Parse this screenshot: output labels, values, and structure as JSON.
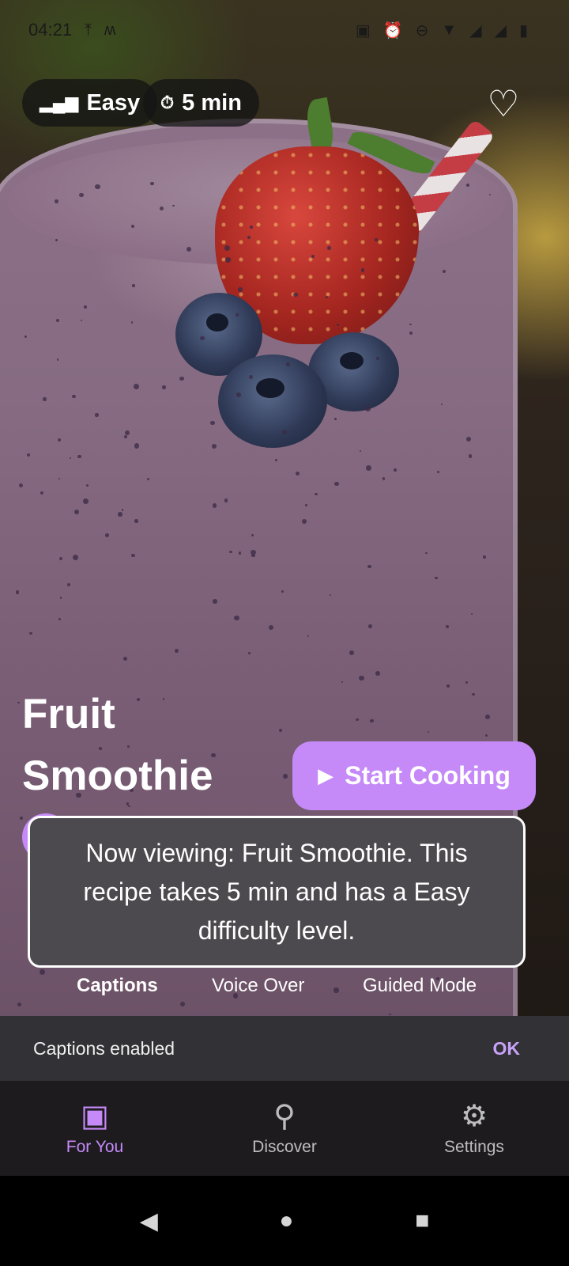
{
  "status_bar": {
    "time": "04:21",
    "left_icons": [
      "upload-icon",
      "m-logo-icon"
    ],
    "right_icons": [
      "nfc-icon",
      "alarm-icon",
      "do-not-disturb-icon",
      "wifi-icon",
      "signal-icon",
      "signal-icon",
      "battery-icon"
    ]
  },
  "recipe": {
    "difficulty": "Easy",
    "time": "5 min",
    "title": "Fruit Smoothie",
    "start_label": "Start Cooking",
    "favorite": false
  },
  "caption": {
    "text": "Now viewing: Fruit Smoothie. This recipe takes 5 min and has a Easy difficulty level."
  },
  "modes": {
    "items": [
      {
        "label": "Captions",
        "active": true
      },
      {
        "label": "Voice Over",
        "active": false
      },
      {
        "label": "Guided Mode",
        "active": false
      }
    ]
  },
  "snackbar": {
    "message": "Captions enabled",
    "action": "OK"
  },
  "bottom_nav": {
    "items": [
      {
        "label": "For You",
        "icon": "video-library-icon",
        "active": true
      },
      {
        "label": "Discover",
        "icon": "search-icon",
        "active": false
      },
      {
        "label": "Settings",
        "icon": "gear-icon",
        "active": false
      }
    ]
  },
  "colors": {
    "accent": "#c58af8",
    "snackbar_bg": "#323135",
    "nav_bg": "#1d1b1e"
  }
}
